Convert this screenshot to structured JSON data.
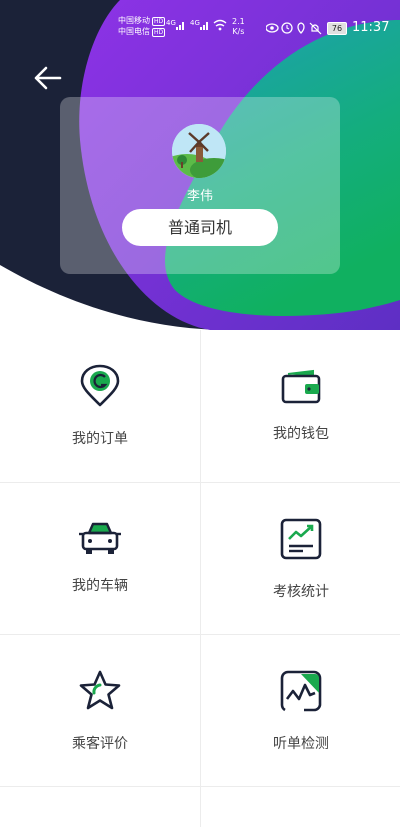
{
  "status_bar": {
    "carrier1": "中国移动",
    "carrier1_badge": "HD",
    "carrier2": "中国电信",
    "carrier2_badge": "HD",
    "net_speed": "2.1",
    "net_unit": "K/s",
    "battery": "76",
    "time": "11:37"
  },
  "header": {
    "back_icon": "arrow-left-icon"
  },
  "profile": {
    "name": "李伟",
    "role_button": "普通司机",
    "avatar_icon": "windmill-landscape-avatar"
  },
  "colors": {
    "accent_green": "#1aa94e",
    "dark_navy": "#1b2238",
    "purple": "#7a2fd3",
    "teal": "#19a4a0"
  },
  "menu": [
    {
      "label": "我的订单",
      "icon": "location-pin-icon"
    },
    {
      "label": "我的钱包",
      "icon": "wallet-icon"
    },
    {
      "label": "我的车辆",
      "icon": "car-icon"
    },
    {
      "label": "考核统计",
      "icon": "stats-chart-icon"
    },
    {
      "label": "乘客评价",
      "icon": "star-icon"
    },
    {
      "label": "听单检测",
      "icon": "signal-check-icon"
    }
  ]
}
